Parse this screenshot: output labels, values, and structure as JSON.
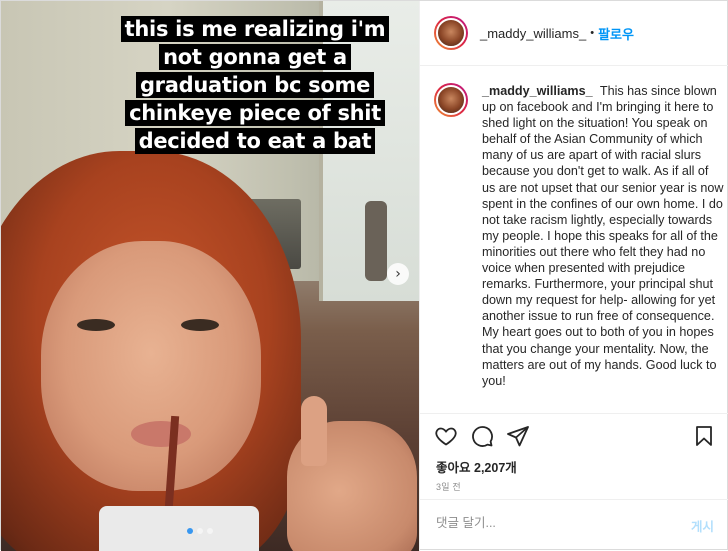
{
  "photo": {
    "caption_lines": [
      "this is me realizing i'm",
      "not gonna get a",
      "graduation bc some",
      "chinkeye piece of shit",
      "decided to eat a bat"
    ],
    "next_icon": "chevron-right-icon",
    "carousel_total": 3,
    "carousel_active": 1
  },
  "header": {
    "username": "_maddy_williams_",
    "separator": "•",
    "follow_label": "팔로우",
    "more_label": "···"
  },
  "comment": {
    "username": "_maddy_williams_",
    "body": "This has since blown up on facebook and I'm bringing it here to shed light on the situation! You speak on behalf of the Asian Community of which many of us are apart of with racial slurs because you don't get to walk. As if all of us are not upset that our senior year is now spent in the confines of our own home. I do not take racism lightly, especially towards my people. I hope this speaks for all of the minorities out there who felt they had no voice when presented with prejudice remarks. Furthermore, your principal shut down my request for help- allowing for yet another issue to run free of consequence. My heart goes out to both of you in hopes that you change your mentality. Now, the matters are out of my hands. Good luck to you!"
  },
  "actions": {
    "like_icon": "heart-icon",
    "comment_icon": "comment-icon",
    "share_icon": "send-icon",
    "save_icon": "bookmark-icon"
  },
  "likes": {
    "label": "좋아요",
    "count": "2,207개"
  },
  "timestamp": "3일 전",
  "comment_input": {
    "placeholder": "댓글 달기...",
    "post_label": "게시"
  },
  "colors": {
    "follow": "#0095f6",
    "post_disabled": "#b2dffc",
    "muted": "#8e8e8e"
  }
}
